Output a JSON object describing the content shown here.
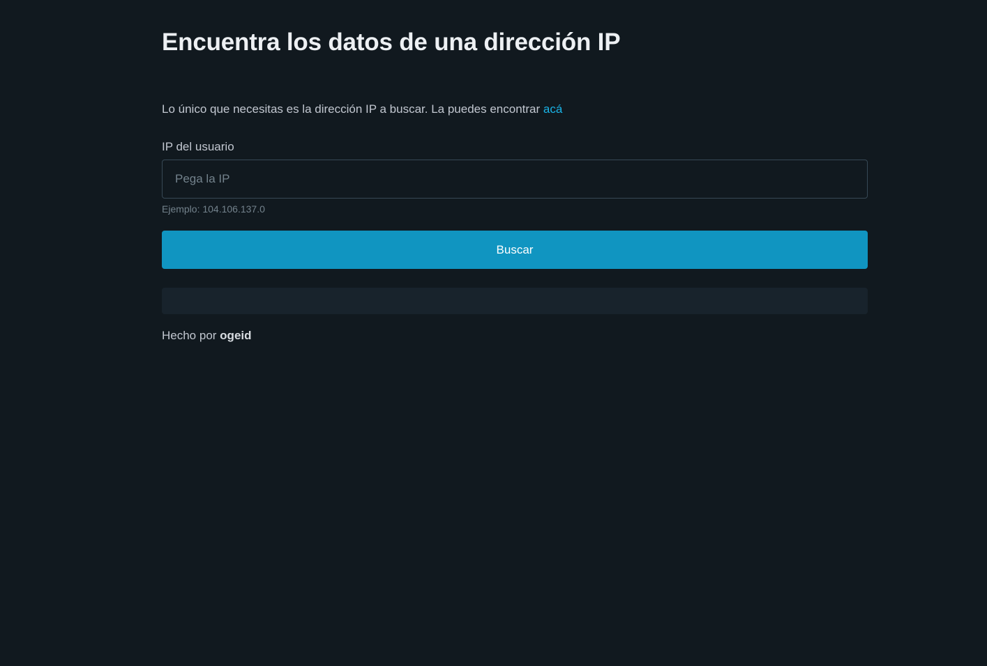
{
  "header": {
    "title": "Encuentra los datos de una dirección IP"
  },
  "intro": {
    "text": "Lo único que necesitas es la dirección IP a buscar. La puedes encontrar ",
    "link_label": "acá"
  },
  "form": {
    "ip_label": "IP del usuario",
    "ip_value": "",
    "ip_placeholder": "Pega la IP",
    "helper_text": "Ejemplo: 104.106.137.0",
    "search_label": "Buscar"
  },
  "result": {
    "text": ""
  },
  "footer": {
    "prefix": "Hecho por ",
    "author": "ogeid"
  },
  "colors": {
    "background": "#11191f",
    "accent": "#1095c1",
    "link": "#1ab3e6"
  }
}
